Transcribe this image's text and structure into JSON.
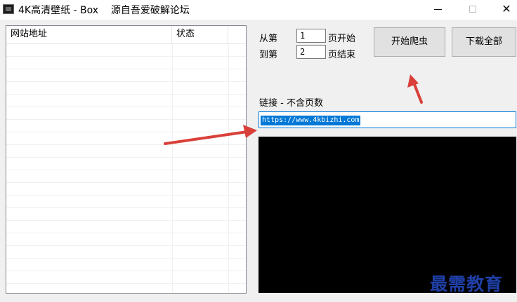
{
  "window": {
    "title": "4K高清壁纸 - Box    源自吾爱破解论坛",
    "icon": "app-icon",
    "controls": {
      "minimize": "minimize-icon",
      "maximize": "maximize-icon",
      "close": "✕"
    }
  },
  "list": {
    "columns": [
      "网站地址",
      "状态"
    ],
    "rows": []
  },
  "range": {
    "from_label": "从第",
    "from_value": "1",
    "from_suffix": "页开始",
    "to_label": "到第",
    "to_value": "2",
    "to_suffix": "页结束"
  },
  "buttons": {
    "crawl": "开始爬虫",
    "download_all": "下载全部"
  },
  "link": {
    "label": "链接 - 不含页数",
    "value": "https://www.4kbizhi.com"
  },
  "colors": {
    "annotation_arrow": "#d9403a",
    "selection": "#0078d7",
    "console_bg": "#000000",
    "watermark": "#1f3fa6"
  },
  "watermark": "最需教育"
}
